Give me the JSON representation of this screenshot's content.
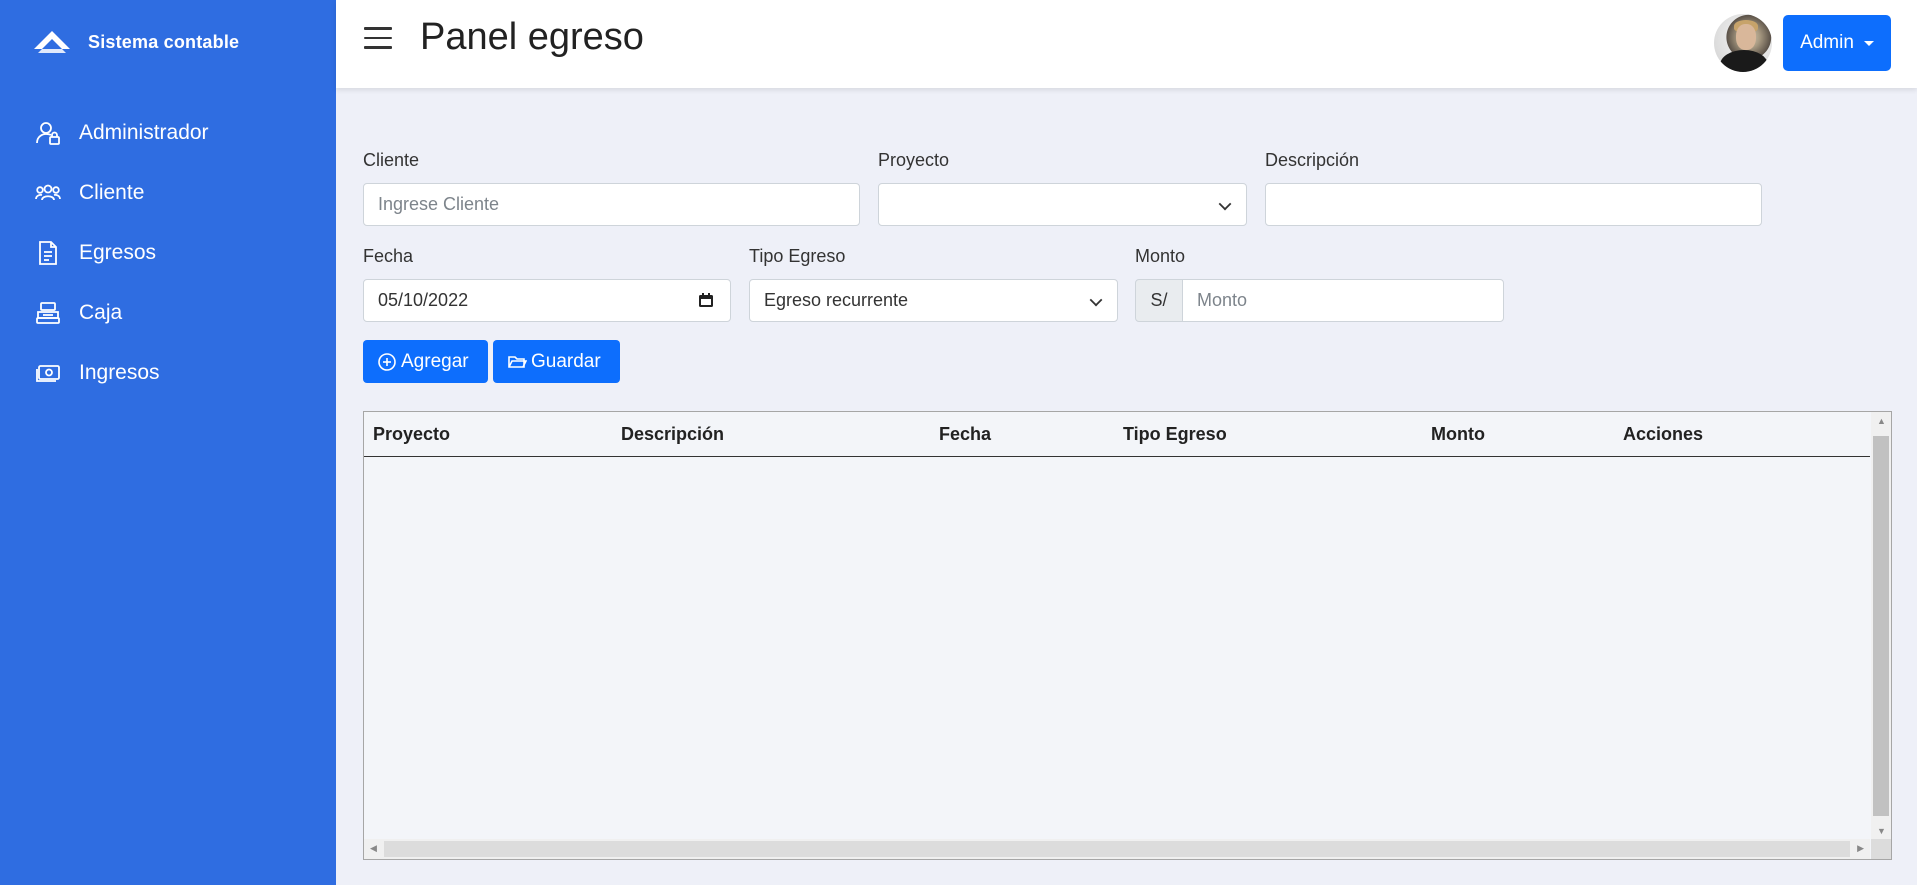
{
  "brand": {
    "name": "Sistema contable"
  },
  "sidebar": {
    "items": [
      {
        "label": "Administrador",
        "icon": "user-lock-icon"
      },
      {
        "label": "Cliente",
        "icon": "users-icon"
      },
      {
        "label": "Egresos",
        "icon": "document-icon"
      },
      {
        "label": "Caja",
        "icon": "cash-register-icon"
      },
      {
        "label": "Ingresos",
        "icon": "money-icon"
      }
    ]
  },
  "header": {
    "title": "Panel egreso",
    "user_button": "Admin"
  },
  "form": {
    "cliente": {
      "label": "Cliente",
      "placeholder": "Ingrese Cliente",
      "value": ""
    },
    "proyecto": {
      "label": "Proyecto",
      "value": ""
    },
    "descripcion": {
      "label": "Descripción",
      "value": ""
    },
    "fecha": {
      "label": "Fecha",
      "value": "05/10/2022"
    },
    "tipo_egreso": {
      "label": "Tipo Egreso",
      "value": "Egreso recurrente"
    },
    "monto": {
      "label": "Monto",
      "prefix": "S/",
      "placeholder": "Monto",
      "value": ""
    }
  },
  "actions": {
    "agregar": "Agregar",
    "guardar": "Guardar"
  },
  "table": {
    "columns": [
      "Proyecto",
      "Descripción",
      "Fecha",
      "Tipo Egreso",
      "Monto",
      "Acciones"
    ],
    "rows": []
  },
  "colors": {
    "sidebar": "#2f6de1",
    "primary": "#0d6efd",
    "background": "#eef0f8"
  }
}
